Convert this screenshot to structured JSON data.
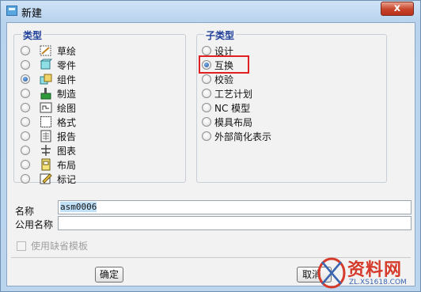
{
  "window": {
    "title": "新建",
    "close_label": "x"
  },
  "type_group": {
    "title": "类型",
    "items": [
      {
        "label": "草绘",
        "icon": "sketch-icon",
        "selected": false
      },
      {
        "label": "零件",
        "icon": "part-icon",
        "selected": false
      },
      {
        "label": "组件",
        "icon": "assembly-icon",
        "selected": true
      },
      {
        "label": "制造",
        "icon": "manufacturing-icon",
        "selected": false
      },
      {
        "label": "绘图",
        "icon": "drawing-icon",
        "selected": false
      },
      {
        "label": "格式",
        "icon": "format-icon",
        "selected": false
      },
      {
        "label": "报告",
        "icon": "report-icon",
        "selected": false
      },
      {
        "label": "图表",
        "icon": "diagram-icon",
        "selected": false
      },
      {
        "label": "布局",
        "icon": "layout-icon",
        "selected": false
      },
      {
        "label": "标记",
        "icon": "markup-icon",
        "selected": false
      }
    ]
  },
  "subtype_group": {
    "title": "子类型",
    "items": [
      {
        "label": "设计",
        "selected": false
      },
      {
        "label": "互换",
        "selected": true
      },
      {
        "label": "校验",
        "selected": false
      },
      {
        "label": "工艺计划",
        "selected": false
      },
      {
        "label": "NC 模型",
        "selected": false
      },
      {
        "label": "模具布局",
        "selected": false
      },
      {
        "label": "外部简化表示",
        "selected": false
      }
    ]
  },
  "form": {
    "name_label": "名称",
    "name_value": "asm0006",
    "common_name_label": "公用名称",
    "common_name_value": "",
    "use_template_label": "使用缺省模板",
    "use_template_checked": false
  },
  "buttons": {
    "ok": "确定",
    "cancel": "取消"
  },
  "watermark": {
    "text": "资料网",
    "url": "ZL.XS1618.COM"
  },
  "colors": {
    "highlight": "#e02020",
    "group_title": "#1f3f99"
  }
}
